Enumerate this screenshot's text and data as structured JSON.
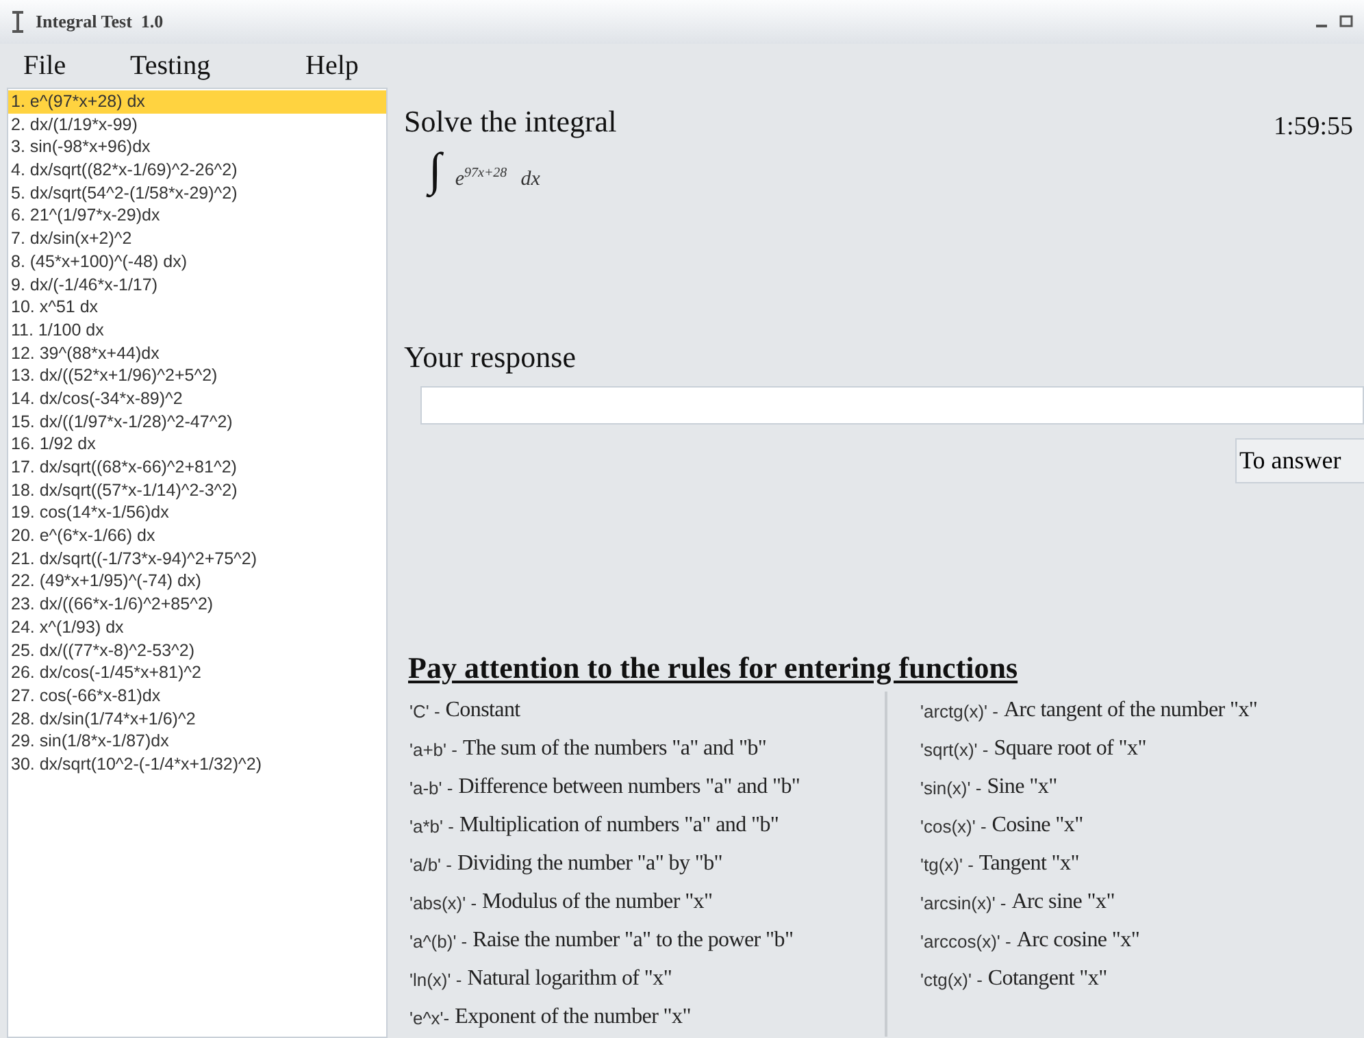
{
  "window": {
    "title": "Integral Test  1.0"
  },
  "menu": [
    "File",
    "Testing",
    "Help"
  ],
  "tasks": [
    {
      "label": "1. e^(97*x+28) dx",
      "selected": true
    },
    {
      "label": "2. dx/(1/19*x-99)",
      "selected": false
    },
    {
      "label": "3. sin(-98*x+96)dx",
      "selected": false
    },
    {
      "label": "4. dx/sqrt((82*x-1/69)^2-26^2)",
      "selected": false
    },
    {
      "label": "5. dx/sqrt(54^2-(1/58*x-29)^2)",
      "selected": false
    },
    {
      "label": "6. 21^(1/97*x-29)dx",
      "selected": false
    },
    {
      "label": "7. dx/sin(x+2)^2",
      "selected": false
    },
    {
      "label": "8. (45*x+100)^(-48) dx)",
      "selected": false
    },
    {
      "label": "9. dx/(-1/46*x-1/17)",
      "selected": false
    },
    {
      "label": "10. x^51 dx",
      "selected": false
    },
    {
      "label": "11. 1/100 dx",
      "selected": false
    },
    {
      "label": "12. 39^(88*x+44)dx",
      "selected": false
    },
    {
      "label": "13. dx/((52*x+1/96)^2+5^2)",
      "selected": false
    },
    {
      "label": "14. dx/cos(-34*x-89)^2",
      "selected": false
    },
    {
      "label": "15. dx/((1/97*x-1/28)^2-47^2)",
      "selected": false
    },
    {
      "label": "16. 1/92 dx",
      "selected": false
    },
    {
      "label": "17. dx/sqrt((68*x-66)^2+81^2)",
      "selected": false
    },
    {
      "label": "18. dx/sqrt((57*x-1/14)^2-3^2)",
      "selected": false
    },
    {
      "label": "19. cos(14*x-1/56)dx",
      "selected": false
    },
    {
      "label": "20. e^(6*x-1/66) dx",
      "selected": false
    },
    {
      "label": "21. dx/sqrt((-1/73*x-94)^2+75^2)",
      "selected": false
    },
    {
      "label": "22. (49*x+1/95)^(-74) dx)",
      "selected": false
    },
    {
      "label": "23. dx/((66*x-1/6)^2+85^2)",
      "selected": false
    },
    {
      "label": "24. x^(1/93) dx",
      "selected": false
    },
    {
      "label": "25. dx/((77*x-8)^2-53^2)",
      "selected": false
    },
    {
      "label": "26. dx/cos(-1/45*x+81)^2",
      "selected": false
    },
    {
      "label": "27. cos(-66*x-81)dx",
      "selected": false
    },
    {
      "label": "28. dx/sin(1/74*x+1/6)^2",
      "selected": false
    },
    {
      "label": "29. sin(1/8*x-1/87)dx",
      "selected": false
    },
    {
      "label": "30. dx/sqrt(10^2-(-1/4*x+1/32)^2)",
      "selected": false
    }
  ],
  "task": {
    "heading": "Solve the integral",
    "timer": "1:59:55",
    "integral": {
      "symbol": "∫",
      "base": "e",
      "exponent": "97x+28",
      "differential": "dx"
    }
  },
  "response": {
    "label": "Your response",
    "button": "To answer"
  },
  "rules": {
    "heading": "Pay attention to the rules for entering functions",
    "left": [
      {
        "code": "'C' -",
        "text": "Constant"
      },
      {
        "code": "'a+b' -",
        "text": "The sum of the numbers \"a\" and \"b\""
      },
      {
        "code": "'a-b' -",
        "text": "Difference between numbers \"a\" and \"b\""
      },
      {
        "code": "'a*b' -",
        "text": "Multiplication of numbers \"a\" and \"b\""
      },
      {
        "code": "'a/b' -",
        "text": "Dividing the number \"a\" by \"b\""
      },
      {
        "code": "'abs(x)' -",
        "text": "Modulus of the number \"x\""
      },
      {
        "code": "'a^(b)' -",
        "text": "Raise the number \"a\" to the power \"b\""
      },
      {
        "code": "'ln(x)' -",
        "text": "Natural logarithm of \"x\""
      },
      {
        "code": "'e^x'-",
        "text": "Exponent of the number \"x\""
      }
    ],
    "right": [
      {
        "code": "'arctg(x)' -",
        "text": "Arc tangent of the number \"x\""
      },
      {
        "code": "'sqrt(x)' -",
        "text": "Square root of \"x\""
      },
      {
        "code": "'sin(x)' -",
        "text": "Sine \"x\""
      },
      {
        "code": "'cos(x)' -",
        "text": "Cosine \"x\""
      },
      {
        "code": "'tg(x)' -",
        "text": "Tangent \"x\""
      },
      {
        "code": "'arcsin(x)' -",
        "text": "Arc sine \"x\""
      },
      {
        "code": "'arccos(x)' -",
        "text": "Arc cosine \"x\""
      },
      {
        "code": "'ctg(x)' -",
        "text": "Cotangent \"x\""
      }
    ]
  }
}
